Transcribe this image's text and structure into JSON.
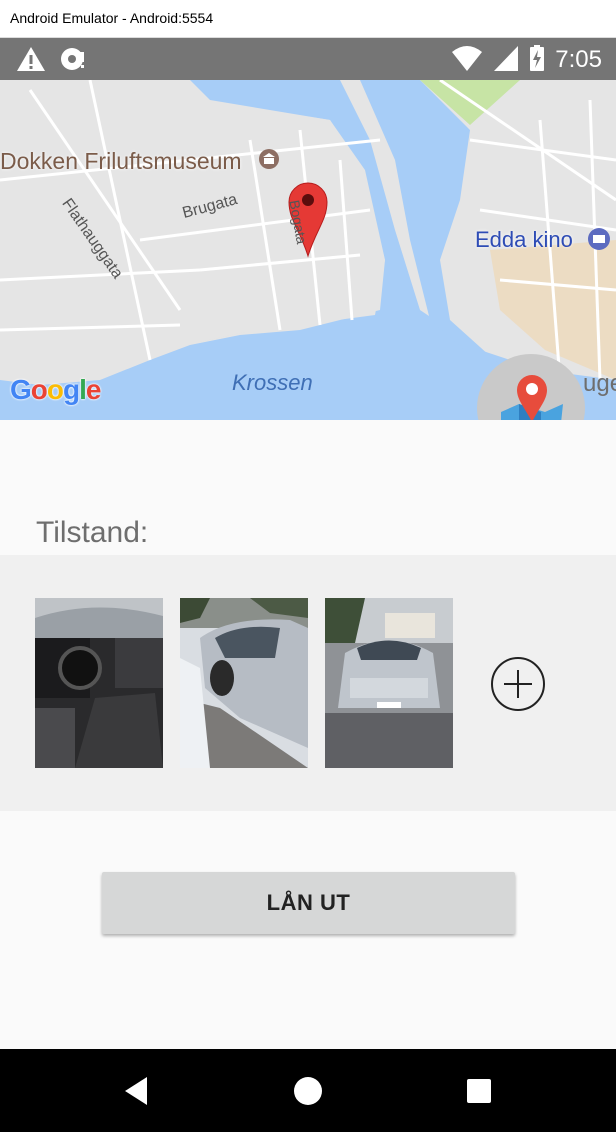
{
  "window": {
    "title": "Android Emulator - Android:5554"
  },
  "status_bar": {
    "time": "7:05",
    "icons": [
      "warning-icon",
      "sync-disabled-icon",
      "wifi-icon",
      "signal-icon",
      "battery-charging-icon"
    ]
  },
  "map": {
    "labels": {
      "museum": "Dokken Friluftsmuseum",
      "street_1": "Brugata",
      "street_2": "Flathauggata",
      "street_3": "Bogata",
      "cinema": "Edda kino",
      "water": "Krossen",
      "edge_text": "uge"
    },
    "logo": "Google",
    "colors": {
      "water": "#a7cdf7",
      "land": "#e5e5e5",
      "road": "#ffffff",
      "park": "#c7e4a5",
      "poi_label": "#7b5c4a",
      "cinema_label": "#2e4cb5"
    },
    "fab_icon": "map-marker-icon"
  },
  "form": {
    "condition_label": "Tilstand:",
    "photos": [
      {
        "description": "car interior",
        "icon": "photo-thumbnail"
      },
      {
        "description": "car side",
        "icon": "photo-thumbnail"
      },
      {
        "description": "car front",
        "icon": "photo-thumbnail"
      }
    ],
    "add_photo_icon": "add-circle-icon",
    "submit_label": "LÅN UT"
  },
  "nav_bar": {
    "icons": [
      "back-icon",
      "home-icon",
      "recents-icon"
    ]
  }
}
